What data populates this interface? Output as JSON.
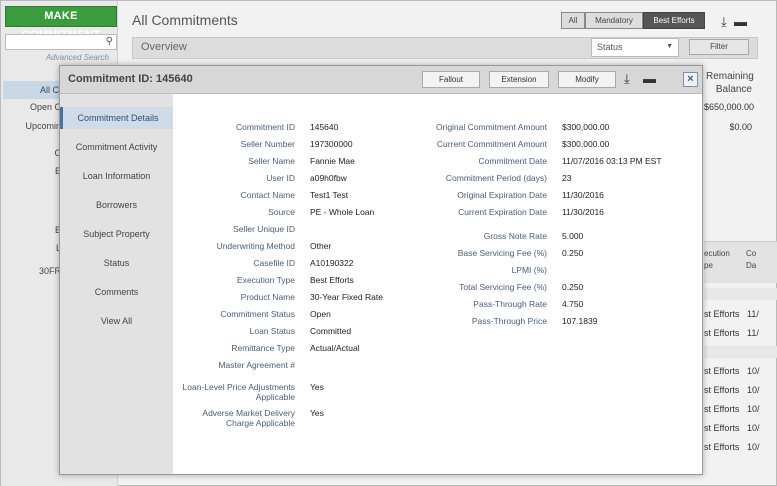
{
  "bg": {
    "make_commitment": "MAKE COMMITMENT",
    "advanced_search": "Advanced Search",
    "page_title": "All Commitments",
    "segments": [
      "All",
      "Mandatory",
      "Best Efforts"
    ],
    "overview": "Overview",
    "status_placeholder": "Status",
    "filter": "Filter",
    "nav": [
      "All C",
      "Open C",
      "Upcomin",
      "C",
      "E",
      "B",
      "L",
      "30FR"
    ],
    "remaining_header_1": "Remaining",
    "remaining_header_2": "Balance",
    "remaining_values": [
      "$650,000.00",
      "$0.00"
    ],
    "exec_header": "ecution\npe",
    "date_header": "Co\nDa",
    "rows": [
      {
        "exec": "st Efforts",
        "date": "11/"
      },
      {
        "exec": "st Efforts",
        "date": "11/"
      },
      {
        "exec": "st Efforts",
        "date": "10/"
      },
      {
        "exec": "st Efforts",
        "date": "10/"
      },
      {
        "exec": "st Efforts",
        "date": "10/"
      },
      {
        "exec": "st Efforts",
        "date": "10/"
      },
      {
        "exec": "st Efforts",
        "date": "10/"
      }
    ]
  },
  "modal": {
    "title": "Commitment ID: 145640",
    "buttons": {
      "fallout": "Fallout",
      "extension": "Extension",
      "modify": "Modify"
    },
    "close": "×",
    "nav": [
      "Commitment Details",
      "Commitment Activity",
      "Loan Information",
      "Borrowers",
      "Subject Property",
      "Status",
      "Comments",
      "View All"
    ],
    "left_fields": [
      {
        "label": "Commitment ID",
        "value": "145640"
      },
      {
        "label": "Seller Number",
        "value": "197300000"
      },
      {
        "label": "Seller Name",
        "value": "Fannie Mae"
      },
      {
        "label": "User ID",
        "value": "a09h0fbw"
      },
      {
        "label": "Contact Name",
        "value": "Test1 Test"
      },
      {
        "label": "Source",
        "value": "PE - Whole Loan"
      },
      {
        "label": "Seller Unique ID",
        "value": ""
      },
      {
        "label": "Underwriting Method",
        "value": "Other"
      },
      {
        "label": "Casefile ID",
        "value": "A10190322"
      },
      {
        "label": "Execution Type",
        "value": "Best Efforts"
      },
      {
        "label": "Product Name",
        "value": "30-Year Fixed Rate"
      },
      {
        "label": "Commitment Status",
        "value": "Open"
      },
      {
        "label": "Loan Status",
        "value": "Committed"
      },
      {
        "label": "Remittance Type",
        "value": "Actual/Actual"
      },
      {
        "label": "Master Agreement #",
        "value": ""
      },
      {
        "label": "Loan-Level Price Adjustments",
        "label2": "Applicable",
        "value": "Yes"
      },
      {
        "label": "Adverse Market Delivery",
        "label2": "Charge Applicable",
        "value": "Yes"
      }
    ],
    "right_fields": [
      {
        "label": "Original Commitment Amount",
        "value": "$300,000.00"
      },
      {
        "label": "Current Commitment Amount",
        "value": "$300,000.00"
      },
      {
        "label": "Commitment Date",
        "value": "11/07/2016 03:13 PM EST"
      },
      {
        "label": "Commitment Period (days)",
        "value": "23"
      },
      {
        "label": "Original Expiration Date",
        "value": "11/30/2016"
      },
      {
        "label": "Current Expiration Date",
        "value": "11/30/2016"
      },
      {
        "label": "Gross Note Rate",
        "value": "5.000"
      },
      {
        "label": "Base Servicing Fee (%)",
        "value": "0.250"
      },
      {
        "label": "LPMI (%)",
        "value": ""
      },
      {
        "label": "Total Servicing Fee (%)",
        "value": "0.250"
      },
      {
        "label": "Pass-Through Rate",
        "value": "4.750"
      },
      {
        "label": "Pass-Through Price",
        "value": "107.1839"
      }
    ]
  }
}
